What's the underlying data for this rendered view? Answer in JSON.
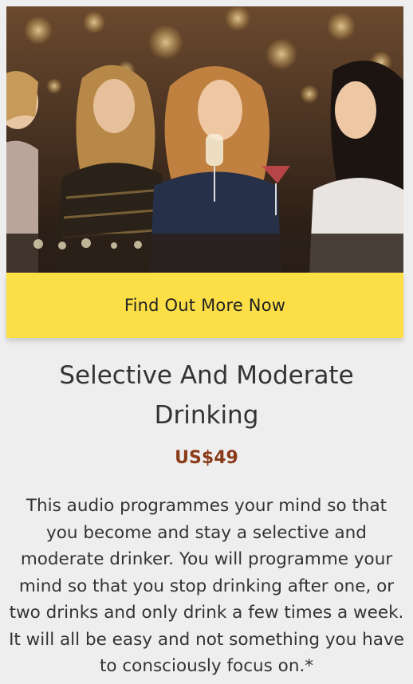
{
  "product": {
    "image_alt": "Women drinking wine and cocktails at a bar",
    "cta_label": "Find Out More Now",
    "title": "Selective And Moderate Drinking",
    "price": "US$49",
    "description": "This audio programmes your mind so that you become and stay a selective and moderate drinker. You will programme your mind so that you stop drinking after one, or two drinks and only drink a few times a week. It will all be easy and not something you have to consciously focus on.*"
  },
  "colors": {
    "cta_background": "#fcdf46",
    "price_text": "#8a3b1a",
    "page_background": "#eeeeee"
  }
}
